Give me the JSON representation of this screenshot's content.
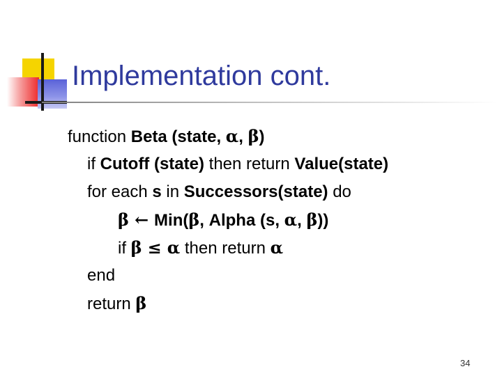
{
  "title": "Implementation cont.",
  "page_number": "34",
  "code": {
    "sig_plain1": "function ",
    "sig_bold1": "Beta (state, ",
    "alpha": "α",
    "beta": "β",
    "comma_space": ", ",
    "close_paren": ")",
    "if_kw": "if ",
    "cutoff": "Cutoff (state)",
    "then_return": " then return ",
    "value_state": "Value(state)",
    "for_each": "for each ",
    "s": "s",
    "in": " in ",
    "successors": "Successors(state)",
    "do": " do",
    "arrow": "←",
    "min_open": "Min(",
    "alpha_call_open": "Alpha (s, ",
    "double_close": "))",
    "leq": "≤",
    "end": "end",
    "return_kw": "return "
  }
}
